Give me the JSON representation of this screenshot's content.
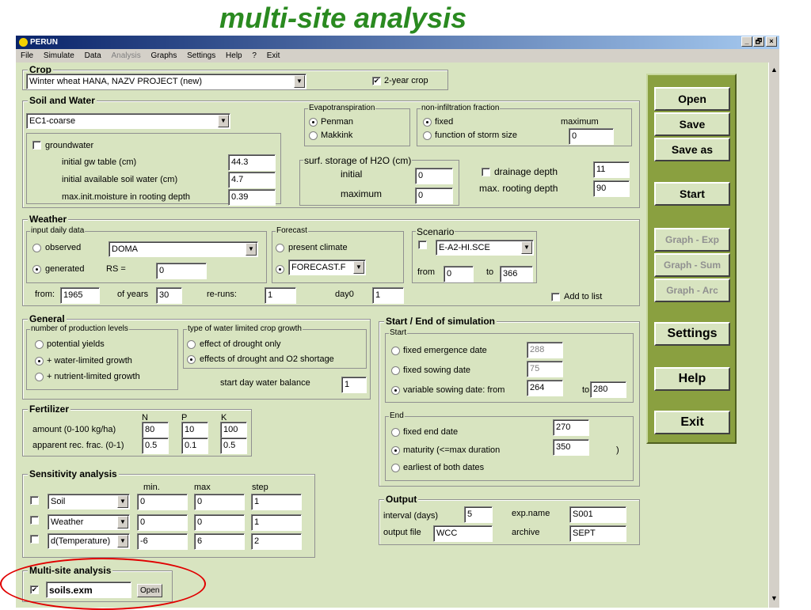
{
  "slide_title": "multi-site analysis",
  "window": {
    "title": "PERUN",
    "min_label": "_",
    "max_label": "🗗",
    "close_label": "×"
  },
  "menu": [
    "File",
    "Simulate",
    "Data",
    "Analysis",
    "Graphs",
    "Settings",
    "Help",
    "?",
    "Exit"
  ],
  "crop": {
    "group_title": "Crop",
    "selected": "Winter wheat HANA, NAZV PROJECT (new)",
    "two_year_label": "2-year crop",
    "two_year_checked": true
  },
  "soil_water": {
    "group_title": "Soil and Water",
    "soil_selected": "EC1-coarse",
    "groundwater_label": "groundwater",
    "gw_table_label": "initial gw table (cm)",
    "gw_table_value": "44.3",
    "avail_water_label": "initial available soil water (cm)",
    "avail_water_value": "4.7",
    "moisture_label": "max.init.moisture in rooting depth",
    "moisture_value": "0.39",
    "evapo_title": "Evapotranspiration",
    "evapo_penman": "Penman",
    "evapo_makkink": "Makkink",
    "noninf_title": "non-infiltration fraction",
    "noninf_fixed": "fixed",
    "noninf_function": "function of storm size",
    "noninf_max_label": "maximum",
    "noninf_max_value": "0",
    "storage_title": "surf. storage of H2O (cm)",
    "storage_initial_label": "initial",
    "storage_initial_value": "0",
    "storage_max_label": "maximum",
    "storage_max_value": "0",
    "drainage_label": "drainage  depth",
    "drainage_value": "11",
    "rooting_label": "max. rooting depth",
    "rooting_value": "90"
  },
  "weather": {
    "group_title": "Weather",
    "input_title": "input daily data",
    "observed_label": "observed",
    "generated_label": "generated",
    "station_value": "DOMA",
    "rs_label": "RS =",
    "rs_value": "0",
    "forecast_title": "Forecast",
    "present_label": "present climate",
    "forecast_value": "FORECAST.F",
    "scenario_title": "Scenario",
    "scenario_value": "E-A2-HI.SCE",
    "from_label": "from",
    "from_value": "0",
    "to_label": "to",
    "to_value": "366",
    "start_from_label": "from:",
    "start_from_value": "1965",
    "years_label": "of years",
    "years_value": "30",
    "reruns_label": "re-runs:",
    "reruns_value": "1",
    "day0_label": "day0",
    "day0_value": "1",
    "add_list_label": "Add to list"
  },
  "general": {
    "group_title": "General",
    "levels_title": "number of production levels",
    "potential_label": "potential yields",
    "water_limited_label": "+ water-limited growth",
    "nutrient_limited_label": "+ nutrient-limited growth",
    "type_title": "type of water limited crop growth",
    "drought_only_label": "effect of drought only",
    "drought_o2_label": "effects of drought and O2 shortage",
    "start_balance_label": "start day water balance",
    "start_balance_value": "1"
  },
  "fertilizer": {
    "group_title": "Fertilizer",
    "headers": [
      "N",
      "P",
      "K"
    ],
    "amount_label": "amount (0-100 kg/ha)",
    "amount_values": [
      "80",
      "10",
      "100"
    ],
    "recovery_label": "apparent rec. frac. (0-1)",
    "recovery_values": [
      "0.5",
      "0.1",
      "0.5"
    ]
  },
  "sensitivity": {
    "group_title": "Sensitivity analysis",
    "headers": [
      "min.",
      "max",
      "step"
    ],
    "rows": [
      {
        "param": "Soil",
        "min": "0",
        "max": "0",
        "step": "1"
      },
      {
        "param": "Weather",
        "min": "0",
        "max": "0",
        "step": "1"
      },
      {
        "param": "d(Temperature)",
        "min": "-6",
        "max": "6",
        "step": "2"
      }
    ]
  },
  "multisite": {
    "group_title": "Multi-site analysis",
    "file_value": "soils.exm",
    "open_label": "Open"
  },
  "simulation": {
    "group_title": "Start / End of simulation",
    "start_title": "Start",
    "fixed_emergence_label": "fixed emergence date",
    "fixed_emergence_value": "288",
    "fixed_sowing_label": "fixed sowing date",
    "fixed_sowing_value": "75",
    "variable_sowing_label": "variable sowing date:  from",
    "variable_from_value": "264",
    "variable_to_label": "to",
    "variable_to_value": "280",
    "end_title": "End",
    "fixed_end_label": "fixed end date",
    "fixed_end_value": "270",
    "maturity_label": "maturity     (<=max duration",
    "maturity_value": "350",
    "maturity_close": ")",
    "earliest_label": "earliest of both dates"
  },
  "output": {
    "group_title": "Output",
    "interval_label": "interval (days)",
    "interval_value": "5",
    "expname_label": "exp.name",
    "expname_value": "S001",
    "outfile_label": "output file",
    "outfile_value": "WCC",
    "archive_label": "archive",
    "archive_value": "SEPT"
  },
  "side_panel": {
    "open": "Open",
    "save": "Save",
    "save_as": "Save as",
    "start": "Start",
    "graph_exp": "Graph - Exp",
    "graph_sum": "Graph - Sum",
    "graph_arc": "Graph - Arc",
    "settings": "Settings",
    "help": "Help",
    "exit": "Exit"
  },
  "colors": {
    "slide_title": "#2a8a20",
    "client_bg": "#d8e4c0",
    "panel_bg": "#8aa040",
    "highlight": "#e00000"
  }
}
